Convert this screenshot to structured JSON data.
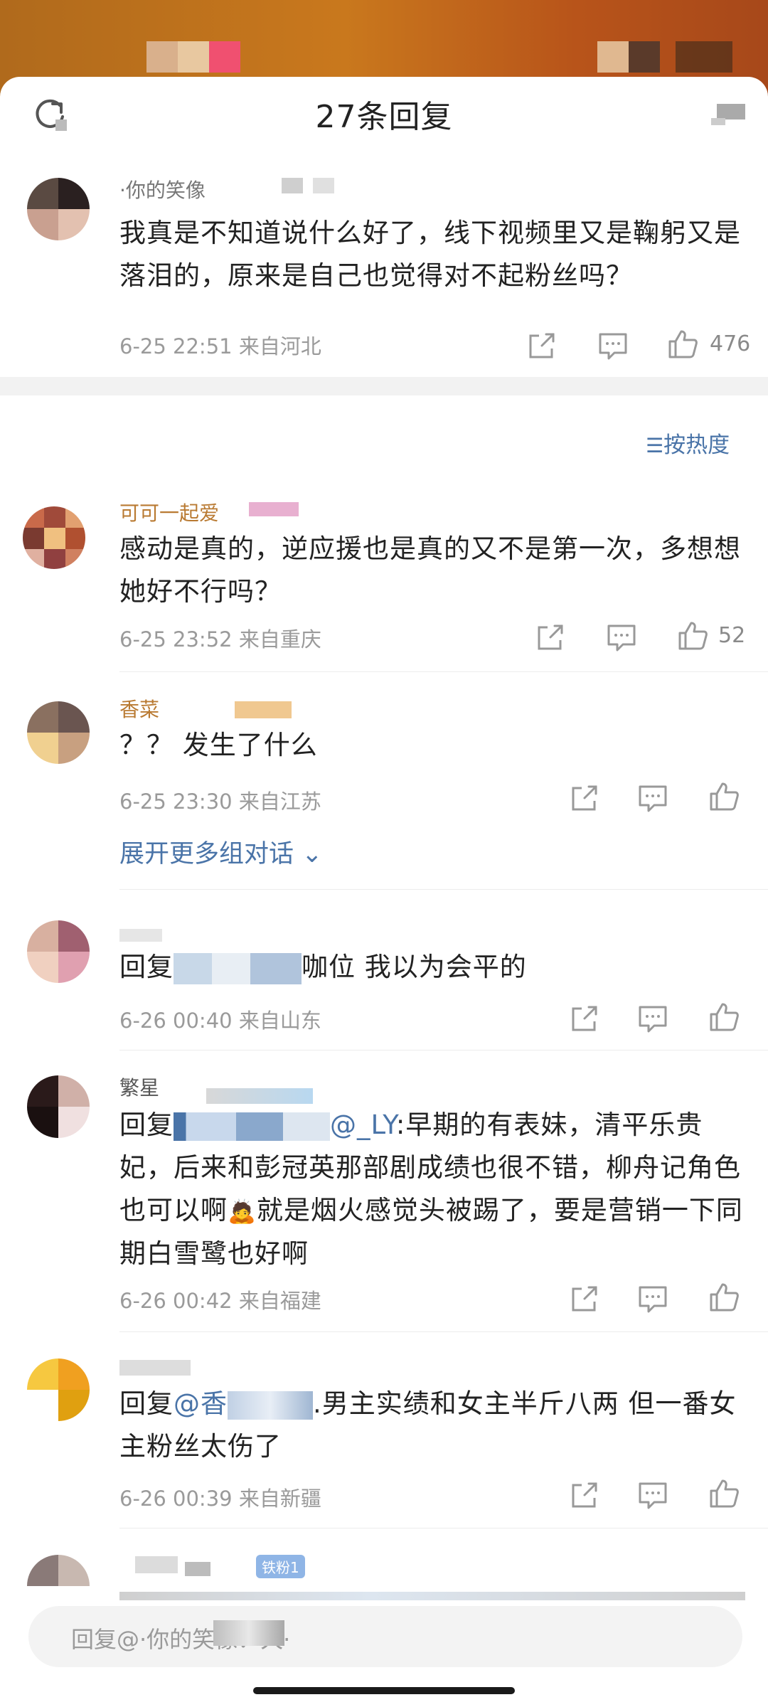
{
  "header": {
    "title": "27条回复",
    "refresh_icon": "refresh-icon",
    "more_icon": "more-icon"
  },
  "pinned": {
    "username": "·你的笑像",
    "text": "我真是不知道说什么好了，线下视频里又是鞠躬又是落泪的，原来是自己也觉得对不起粉丝吗？",
    "time": "6-25 22:51",
    "location": "来自河北",
    "likes": "476"
  },
  "sort": {
    "label": "按热度"
  },
  "comments": [
    {
      "username": "可可一起爱",
      "text": "感动是真的，逆应援也是真的又不是第一次，多想想她好不行吗？",
      "time": "6-25 23:52",
      "location": "来自重庆",
      "likes": "52"
    },
    {
      "username": "香菜",
      "text": "？？ 发生了什么",
      "time": "6-25 23:30",
      "location": "来自江苏",
      "likes": ""
    },
    {
      "username": "",
      "text_prefix": "回复",
      "text_suffix": "咖位 我以为会平的",
      "time": "6-26 00:40",
      "location": "来自山东",
      "likes": ""
    },
    {
      "username": "繁星",
      "text_prefix": "回复",
      "mention": "@_LY",
      "text_suffix": ":早期的有表妹，清平乐贵妃，后来和彭冠英那部剧成绩也很不错，柳舟记角色也可以啊",
      "text_suffix2": "就是烟火感觉头被踢了，要是营销一下同期白雪鹭也好啊",
      "time": "6-26 00:42",
      "location": "来自福建",
      "likes": ""
    },
    {
      "username": "",
      "text_prefix": "回复",
      "mention": "@香",
      "text_suffix": ".男主实绩和女主半斤八两 但一番女主粉丝太伤了",
      "time": "6-26 00:39",
      "location": "来自新疆",
      "likes": ""
    }
  ],
  "expand": {
    "label": "展开更多组对话"
  },
  "partial": {
    "badge": "铁粉1"
  },
  "input": {
    "placeholder": "回复@·你的笑像：犬·"
  },
  "colors": {
    "accent": "#4a74a8",
    "meta": "#9a9a9a",
    "username_gold": "#b97a32"
  }
}
